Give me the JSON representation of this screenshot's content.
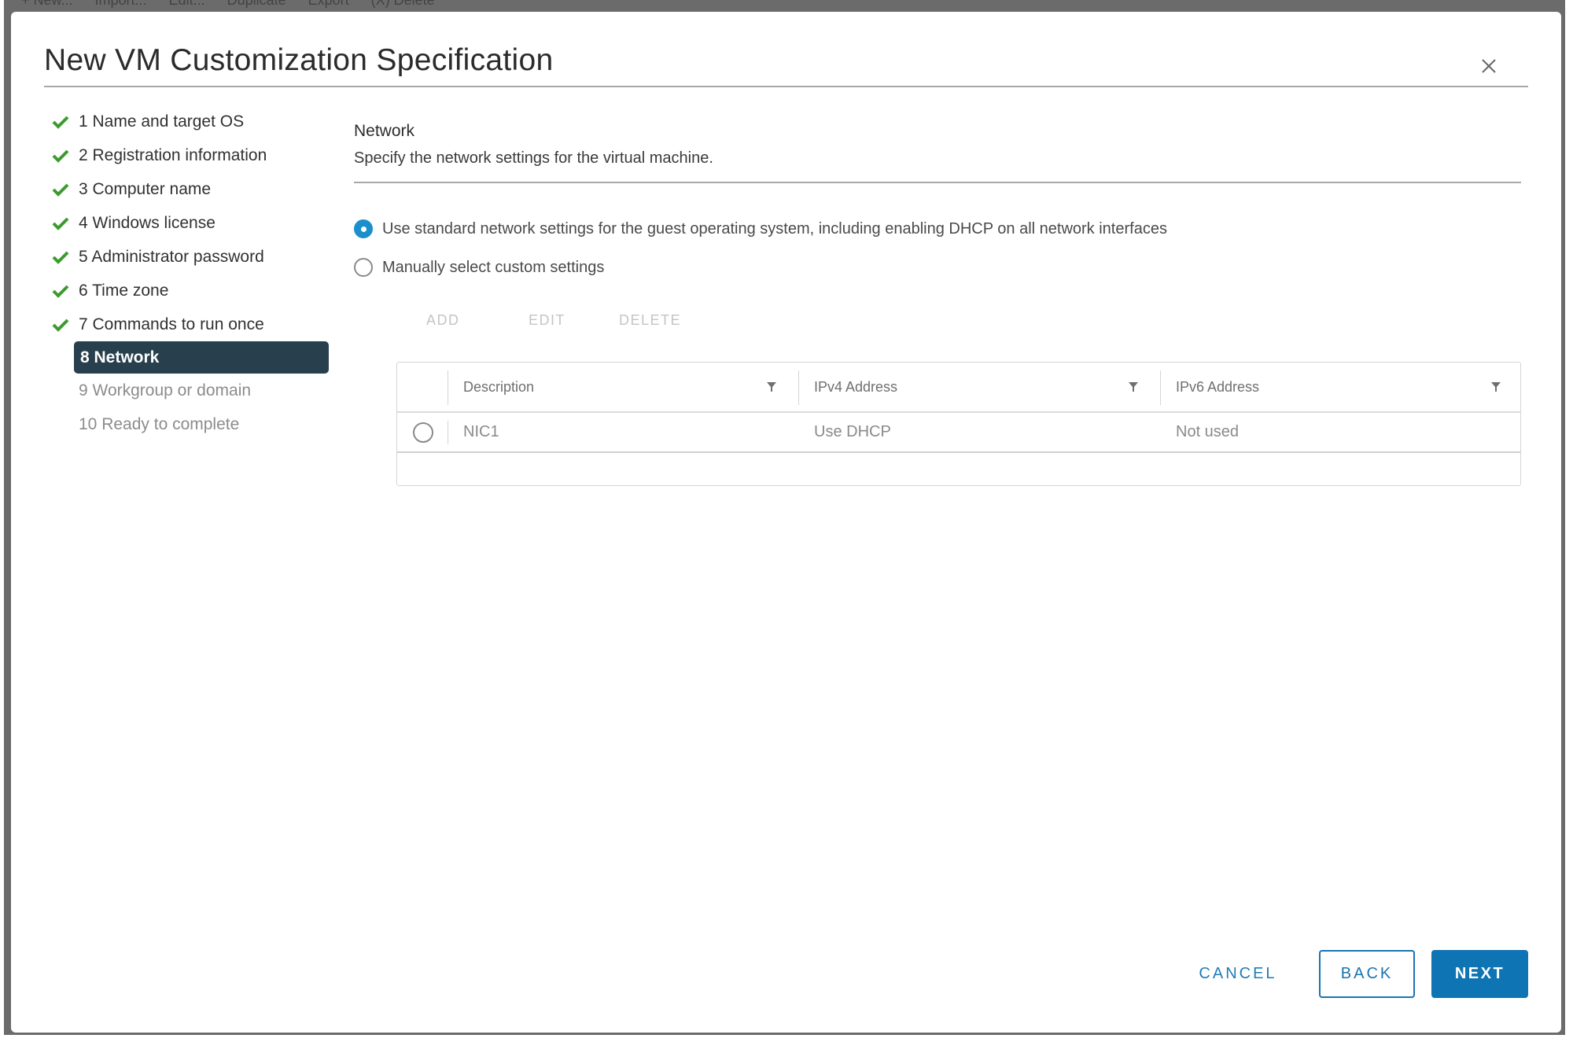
{
  "background_toolbar": [
    "+ New...",
    "Import...",
    "Edit...",
    "Duplicate",
    "Export",
    "(X) Delete"
  ],
  "dialog": {
    "title": "New VM Customization Specification",
    "close_icon": "close-icon"
  },
  "steps": [
    {
      "label": "1 Name and target OS",
      "state": "complete"
    },
    {
      "label": "2 Registration information",
      "state": "complete"
    },
    {
      "label": "3 Computer name",
      "state": "complete"
    },
    {
      "label": "4 Windows license",
      "state": "complete"
    },
    {
      "label": "5 Administrator password",
      "state": "complete"
    },
    {
      "label": "6 Time zone",
      "state": "complete"
    },
    {
      "label": "7 Commands to run once",
      "state": "complete"
    },
    {
      "label": "8 Network",
      "state": "active"
    },
    {
      "label": "9 Workgroup or domain",
      "state": "pending"
    },
    {
      "label": "10 Ready to complete",
      "state": "pending"
    }
  ],
  "page": {
    "title": "Network",
    "subtitle": "Specify the network settings for the virtual machine.",
    "options": [
      {
        "label": "Use standard network settings for the guest operating system, including enabling DHCP on all network interfaces",
        "checked": true
      },
      {
        "label": "Manually select custom settings",
        "checked": false
      }
    ],
    "actions": {
      "add": "ADD",
      "edit": "EDIT",
      "delete": "DELETE"
    },
    "table": {
      "columns": [
        "Description",
        "IPv4 Address",
        "IPv6 Address"
      ],
      "rows": [
        {
          "description": "NIC1",
          "ipv4": "Use DHCP",
          "ipv6": "Not used",
          "selected": false
        }
      ]
    }
  },
  "footer": {
    "cancel": "CANCEL",
    "back": "BACK",
    "next": "NEXT"
  },
  "colors": {
    "accent": "#0f74b3",
    "success": "#3c9a2f",
    "active_step": "#28404e",
    "radio_selected": "#1b8fcc"
  }
}
